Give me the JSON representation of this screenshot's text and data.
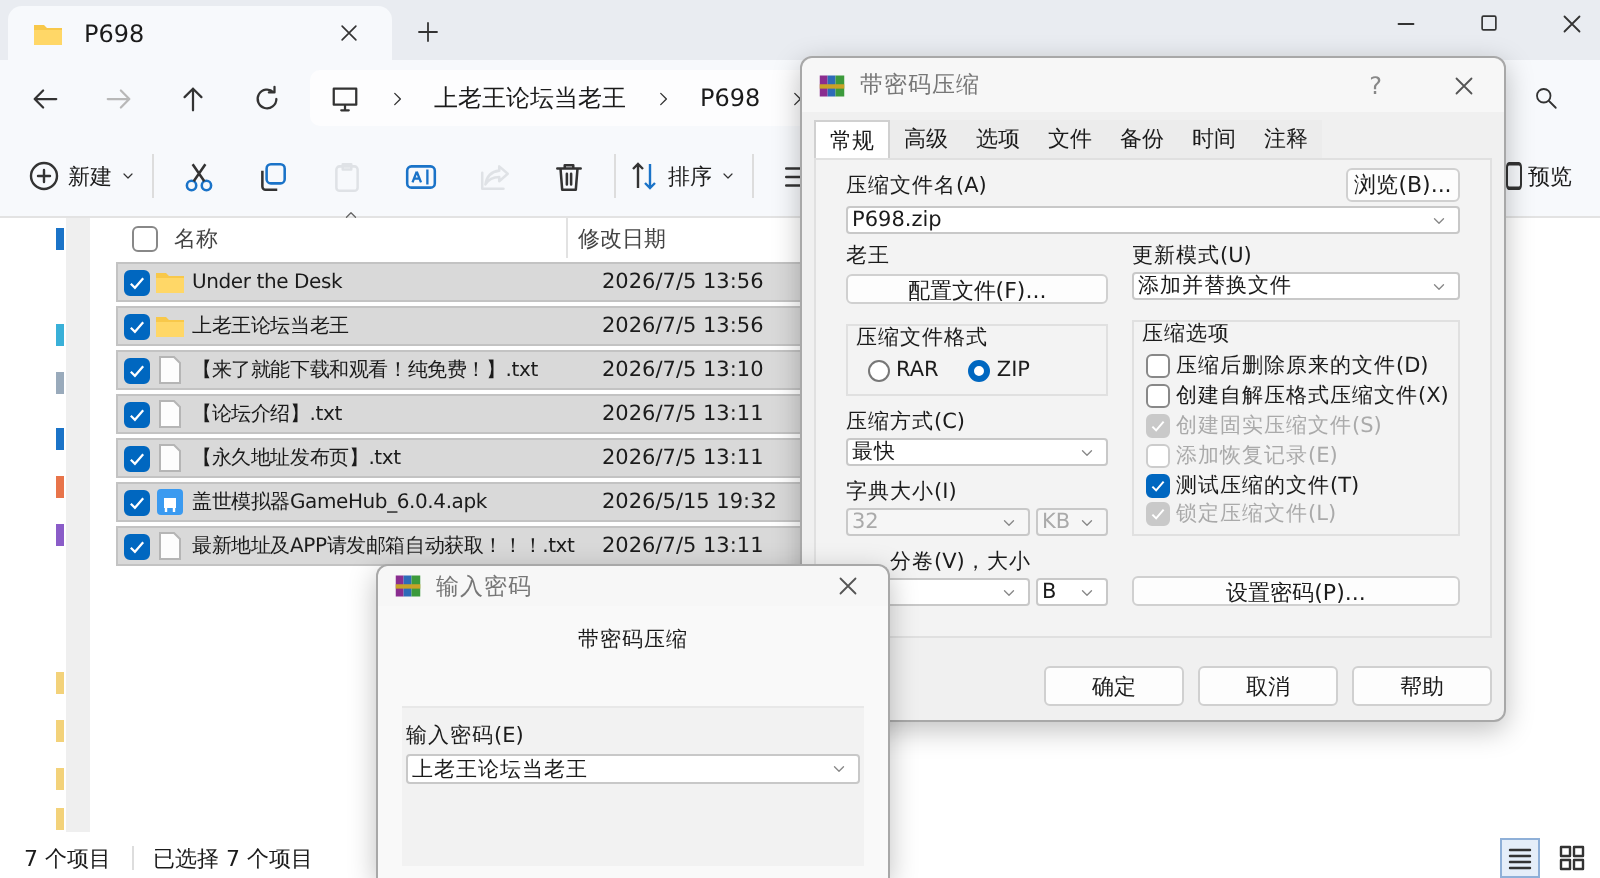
{
  "explorer": {
    "tabs": [
      {
        "label": "P698",
        "selected": true
      }
    ],
    "nav": [
      {
        "kind": "back",
        "disabled": false
      },
      {
        "kind": "forward",
        "disabled": true
      },
      {
        "kind": "up",
        "disabled": false
      },
      {
        "kind": "refresh",
        "disabled": false
      }
    ],
    "breadcrumb": [
      "上老王论坛当老王",
      "P698"
    ],
    "toolbar": [
      {
        "kind": "new",
        "label": "新建",
        "disabled": false
      },
      {
        "kind": "cut",
        "disabled": false
      },
      {
        "kind": "copy",
        "disabled": false
      },
      {
        "kind": "paste",
        "disabled": true
      },
      {
        "kind": "rename",
        "disabled": false
      },
      {
        "kind": "share",
        "disabled": true
      },
      {
        "kind": "delete",
        "disabled": false
      },
      {
        "kind": "sort",
        "label": "排序",
        "disabled": false
      },
      {
        "kind": "more",
        "disabled": false
      }
    ],
    "preview": "预览",
    "select_all": {
      "checked": false
    },
    "columns": [
      "名称",
      "修改日期"
    ],
    "files": [
      {
        "name": "Under the Desk",
        "date": "2026/7/5 13:56",
        "kind": "folder",
        "selected": true
      },
      {
        "name": "上老王论坛当老王",
        "date": "2026/7/5 13:56",
        "kind": "folder",
        "selected": true
      },
      {
        "name": "【来了就能下载和观看！纯免费！】.txt",
        "date": "2026/7/5 13:10",
        "kind": "text",
        "selected": true
      },
      {
        "name": "【论坛介绍】.txt",
        "date": "2026/7/5 13:11",
        "kind": "text",
        "selected": true
      },
      {
        "name": "【永久地址发布页】.txt",
        "date": "2026/7/5 13:11",
        "kind": "text",
        "selected": true
      },
      {
        "name": "盖世模拟器GameHub_6.0.4.apk",
        "date": "2026/5/15 19:32",
        "kind": "app",
        "selected": true
      },
      {
        "name": "最新地址及APP请发邮箱自动获取！！！.txt",
        "date": "2026/7/5 13:11",
        "kind": "text",
        "selected": true
      }
    ],
    "status": [
      "7 个项目",
      "已选择 7 个项目"
    ],
    "views": [
      {
        "kind": "details",
        "selected": true
      },
      {
        "kind": "tiles",
        "selected": false
      }
    ]
  },
  "archive_dialog": {
    "title": "带密码压缩",
    "help_button": "?",
    "tabs": [
      {
        "label": "常规",
        "selected": true
      },
      {
        "label": "高级",
        "selected": false
      },
      {
        "label": "选项",
        "selected": false
      },
      {
        "label": "文件",
        "selected": false
      },
      {
        "label": "备份",
        "selected": false
      },
      {
        "label": "时间",
        "selected": false
      },
      {
        "label": "注释",
        "selected": false
      }
    ],
    "archive_name_label": "压缩文件名(A)",
    "browse_button": "浏览(B)...",
    "archive_name": "P698.zip",
    "profile_label": "老王",
    "profile_button": "配置文件(F)...",
    "update_label": "更新模式(U)",
    "update_mode": "添加并替换文件",
    "format_label": "压缩文件格式",
    "formats": [
      {
        "label": "RAR",
        "selected": false
      },
      {
        "label": "ZIP",
        "selected": true
      }
    ],
    "method_label": "压缩方式(C)",
    "method": "最快",
    "dictionary": {
      "label": "字典大小(I)",
      "value": "32",
      "unit": "KB",
      "disabled": true
    },
    "split": {
      "label": "分卷(V)，大小",
      "unit": "B"
    },
    "options_label": "压缩选项",
    "options": [
      {
        "label": "压缩后删除原来的文件(D)",
        "checked": false,
        "disabled": false
      },
      {
        "label": "创建自解压格式压缩文件(X)",
        "checked": false,
        "disabled": false
      },
      {
        "label": "创建固实压缩文件(S)",
        "checked": true,
        "disabled": true
      },
      {
        "label": "添加恢复记录(E)",
        "checked": false,
        "disabled": true
      },
      {
        "label": "测试压缩的文件(T)",
        "checked": true,
        "disabled": false
      },
      {
        "label": "锁定压缩文件(L)",
        "checked": true,
        "disabled": true
      }
    ],
    "password_button": "设置密码(P)...",
    "buttons": [
      "确定",
      "取消",
      "帮助"
    ]
  },
  "password_dialog": {
    "title": "输入密码",
    "heading": "带密码压缩",
    "password_label": "输入密码(E)",
    "password": "上老王论坛当老王"
  }
}
